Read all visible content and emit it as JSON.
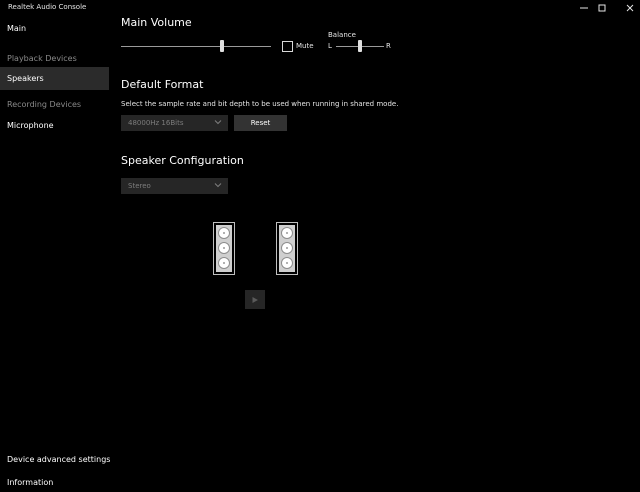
{
  "app": {
    "title": "Realtek Audio Console"
  },
  "window_controls": {
    "minimize": "–",
    "maximize": "▢",
    "close": "✕"
  },
  "sidebar": {
    "main": "Main",
    "playback_section": "Playback Devices",
    "speakers": "Speakers",
    "recording_section": "Recording Devices",
    "microphone": "Microphone",
    "advanced": "Device advanced settings",
    "information": "Information"
  },
  "volume": {
    "heading": "Main Volume",
    "level": 0.67,
    "mute_label": "Mute",
    "muted": false,
    "balance_label": "Balance",
    "left": "L",
    "right": "R",
    "balance_level": 0.5
  },
  "format": {
    "heading": "Default Format",
    "description": "Select the sample rate and bit depth to be used when running in shared mode.",
    "selected": "48000Hz 16Bits",
    "reset_label": "Reset"
  },
  "config": {
    "heading": "Speaker Configuration",
    "selected": "Stereo"
  },
  "colors": {
    "background": "#000000",
    "selected_nav": "#2b2b2b",
    "control": "#262626",
    "button": "#333333"
  },
  "icons": {
    "dropdown": "chevron-down-icon",
    "play": "play-icon",
    "speaker": "speaker-icon"
  }
}
